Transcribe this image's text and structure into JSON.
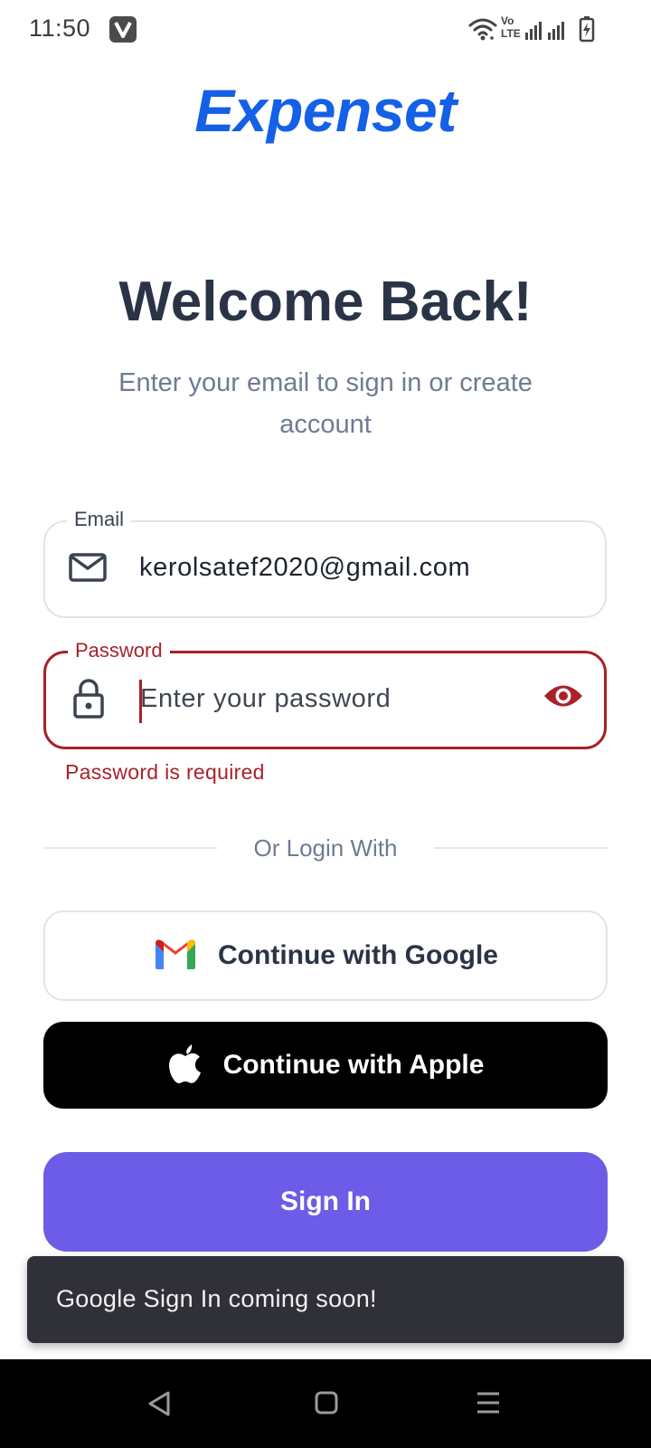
{
  "status_bar": {
    "time": "11:50",
    "badge_letter": "V",
    "network_label_top": "Vo",
    "network_label_bottom": "LTE"
  },
  "brand": {
    "name": "Expenset",
    "color": "#1460e6"
  },
  "heading": {
    "title": "Welcome Back!",
    "subtitle": "Enter your email to sign in or create account"
  },
  "form": {
    "email": {
      "label": "Email",
      "value": "kerolsatef2020@gmail.com",
      "icon": "mail-icon"
    },
    "password": {
      "label": "Password",
      "placeholder": "Enter your password",
      "value": "",
      "icon": "lock-icon",
      "toggle_icon": "eye-icon",
      "error": "Password is required",
      "error_color": "#a8222a"
    }
  },
  "divider": {
    "text": "Or Login With"
  },
  "buttons": {
    "google": {
      "label": "Continue with Google",
      "icon": "gmail-icon"
    },
    "apple": {
      "label": "Continue with Apple",
      "icon": "apple-icon"
    },
    "signin": {
      "label": "Sign In",
      "color": "#6c5ce7"
    }
  },
  "snackbar": {
    "message": "Google Sign In coming soon!"
  },
  "nav": {
    "back_icon": "back-triangle-icon",
    "home_icon": "home-square-icon",
    "menu_icon": "menu-lines-icon"
  }
}
